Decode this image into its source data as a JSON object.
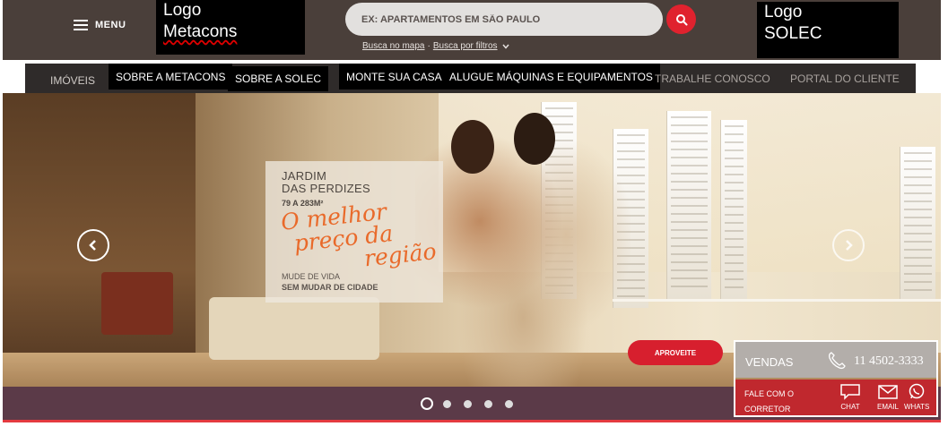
{
  "header": {
    "menu_label": "MENU",
    "logo_metacons": [
      "Logo",
      "Metacons"
    ],
    "logo_solec": [
      "Logo",
      "SOLEC"
    ],
    "search": {
      "placeholder": "EX: APARTAMENTOS EM SÃO PAULO",
      "link_map": "Busca no mapa",
      "separator": "·",
      "link_filters": "Busca por filtros"
    }
  },
  "nav": {
    "items": [
      {
        "label": "IMÓVEIS"
      },
      {
        "label": "SOBRE A METACONS"
      },
      {
        "label": "SOBRE A SOLEC"
      },
      {
        "label": "MONTE SUA CASA"
      },
      {
        "label": "ALUGUE MÁQUINAS E EQUIPAMENTOS"
      },
      {
        "label": "TRABALHE CONOSCO"
      },
      {
        "label": "PORTAL DO CLIENTE"
      }
    ]
  },
  "hero": {
    "title_line1": "JARDIM",
    "title_line2": "DAS PERDIZES",
    "size": "79 A 283M²",
    "slogan": [
      "O melhor",
      "preço da",
      "região"
    ],
    "cta_line1": "MUDE DE VIDA",
    "cta_line2": "SEM MUDAR DE CIDADE",
    "button": "APROVEITE",
    "slides_total": 5,
    "active_slide": 1
  },
  "sales": {
    "label": "VENDAS",
    "phone": "11 4502-3333",
    "fale_line1": "FALE COM O",
    "fale_line2": "CORRETOR",
    "chat": "CHAT",
    "email": "EMAIL",
    "whats": "WHATS"
  },
  "colors": {
    "accent_red": "#e0222e",
    "header_bg": "#4a3f3a",
    "dots_bar": "#5b3a48",
    "slogan_orange": "#e96a2a"
  }
}
